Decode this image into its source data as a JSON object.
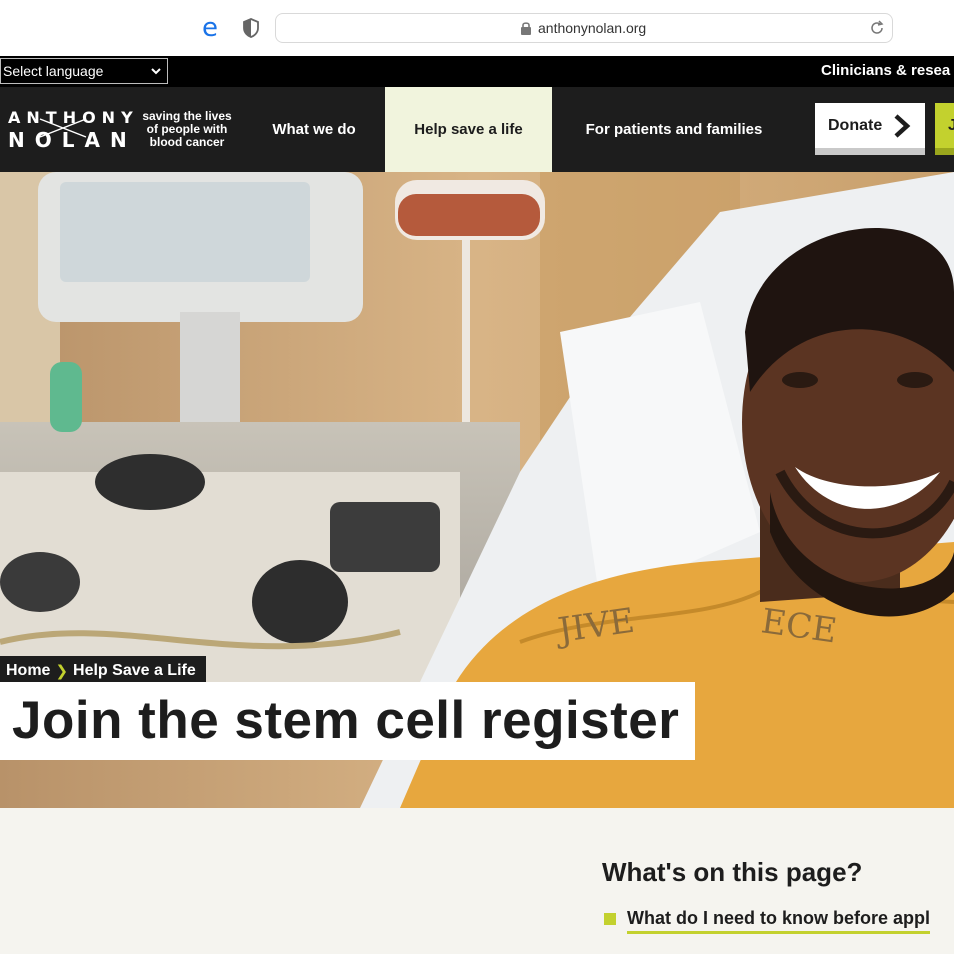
{
  "browser": {
    "url": "anthonynolan.org"
  },
  "utility_bar": {
    "language_select": "Select language",
    "clinicians_link": "Clinicians & resea"
  },
  "header": {
    "logo_line1": "ANTHONY",
    "logo_line2": "NOLAN",
    "tagline": "saving the lives of people with blood cancer",
    "nav": [
      {
        "label": "What we do"
      },
      {
        "label": "Help save a life"
      },
      {
        "label": "For patients and families"
      }
    ],
    "donate_label": "Donate",
    "join_label": "J"
  },
  "hero": {
    "breadcrumb_home": "Home",
    "breadcrumb_current": "Help Save a Life",
    "title": "Join the stem cell register"
  },
  "toc": {
    "title": "What's on this page?",
    "items": [
      {
        "label": "What do I need to know before appl"
      }
    ]
  },
  "colors": {
    "brand_dark": "#1d1d1d",
    "accent_green": "#c3d12e",
    "active_nav_bg": "#f1f4dd",
    "page_bg": "#f5f4ef"
  }
}
